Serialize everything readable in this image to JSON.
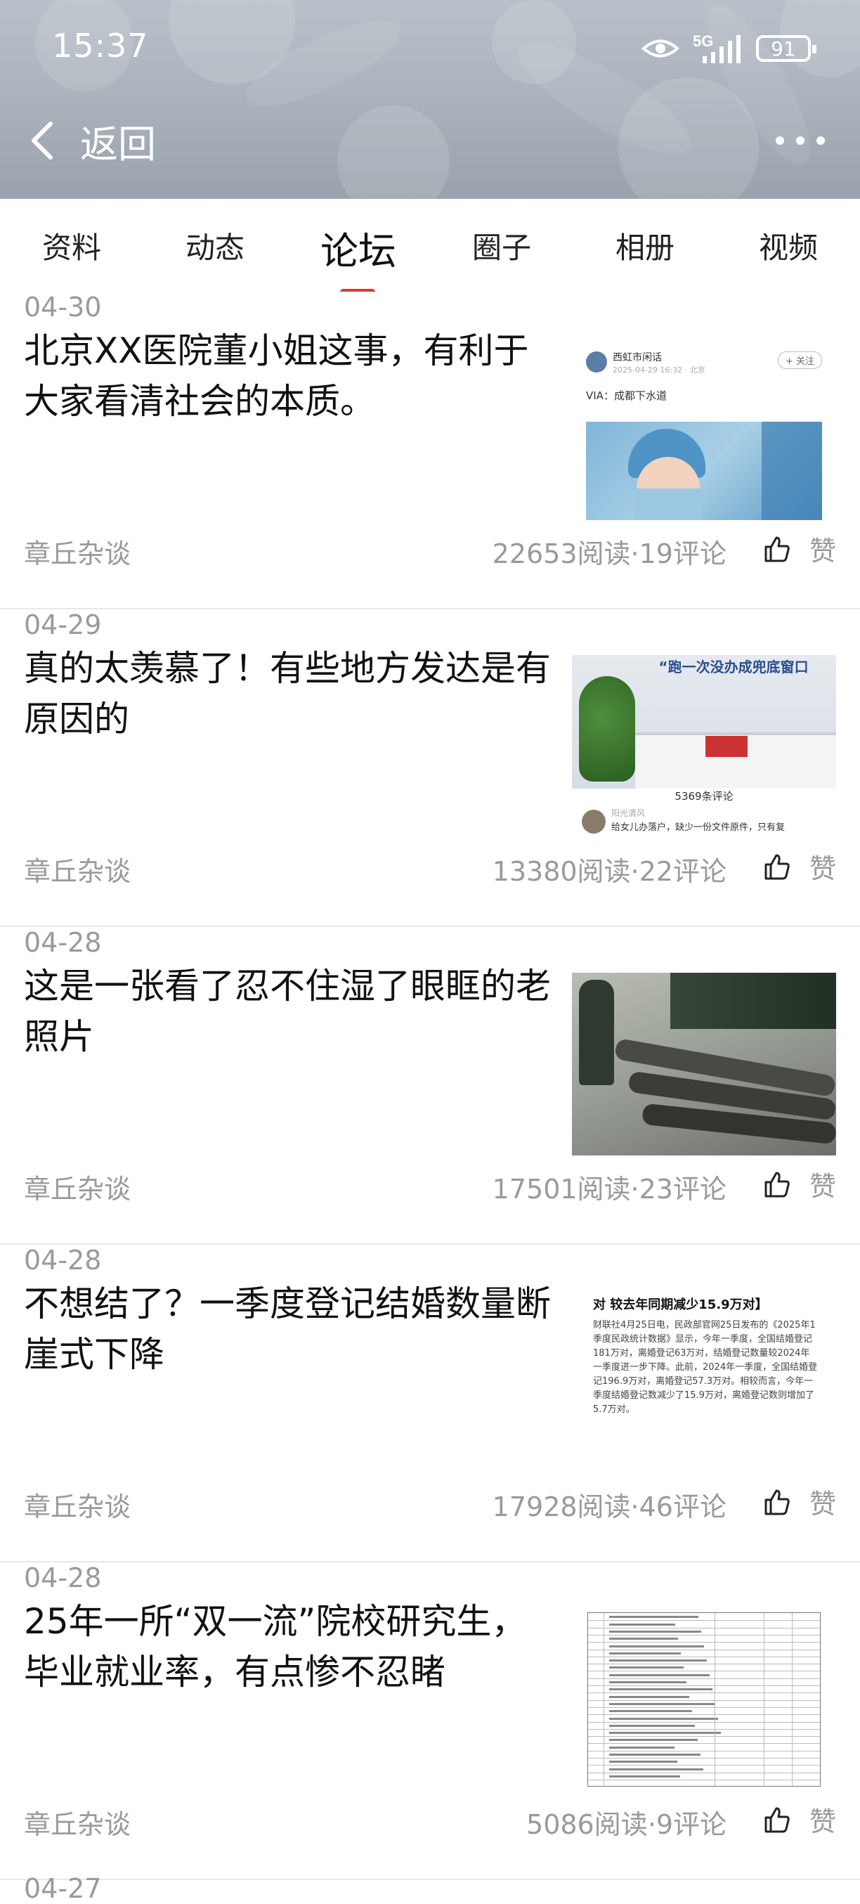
{
  "status_bar": {
    "time": "15:37",
    "network": "5G",
    "battery": "91"
  },
  "nav": {
    "back_label": "返回"
  },
  "tabs": [
    {
      "label": "资料"
    },
    {
      "label": "动态"
    },
    {
      "label": "论坛",
      "active": true
    },
    {
      "label": "圈子"
    },
    {
      "label": "相册"
    },
    {
      "label": "视频"
    }
  ],
  "posts": [
    {
      "date": "04-30",
      "title": "北京XX医院董小姐这事，有利于大家看清社会的本质。",
      "source": "章丘杂谈",
      "stats": "22653阅读·19评论",
      "like_label": "赞",
      "thumb": {
        "account": "西虹市闲话",
        "time": "2025-04-29 16:32 · 北京",
        "follow": "+ 关注",
        "via": "VIA：成都下水道"
      }
    },
    {
      "date": "04-29",
      "title": "真的太羡慕了！有些地方发达是有原因的",
      "source": "章丘杂谈",
      "stats": "13380阅读·22评论",
      "like_label": "赞",
      "thumb": {
        "banner": "“跑一次没办成兜底窗口",
        "comments": "5369条评论",
        "user": "阳光清风",
        "comment": "给女儿办落户，缺少一份文件原件，只有复"
      }
    },
    {
      "date": "04-28",
      "title": "这是一张看了忍不住湿了眼眶的老照片",
      "source": "章丘杂谈",
      "stats": "17501阅读·23评论",
      "like_label": "赞",
      "thumb": {}
    },
    {
      "date": "04-28",
      "title": "不想结了？一季度登记结婚数量断崖式下降",
      "source": "章丘杂谈",
      "stats": "17928阅读·46评论",
      "like_label": "赞",
      "thumb": {
        "heading": "对 较去年同期减少15.9万对】",
        "body": "财联社4月25日电，民政部官网25日发布的《2025年1季度民政统计数据》显示，今年一季度，全国结婚登记181万对，离婚登记63万对，结婚登记数量较2024年一季度进一步下降。此前，2024年一季度，全国结婚登记196.9万对，离婚登记57.3万对。相较而言，今年一季度结婚登记数减少了15.9万对，离婚登记数则增加了5.7万对。"
      }
    },
    {
      "date": "04-28",
      "title": "25年一所“双一流”院校研究生，毕业就业率，有点惨不忍睹",
      "source": "章丘杂谈",
      "stats": "5086阅读·9评论",
      "like_label": "赞",
      "thumb": {}
    }
  ],
  "next_post": {
    "date": "04-27"
  },
  "colors": {
    "accent": "#e0382e",
    "muted_text": "#9a9a9a"
  },
  "icons": [
    "chevron-left-icon",
    "eye-icon",
    "signal-icon",
    "more-icon",
    "thumbs-up-icon"
  ]
}
